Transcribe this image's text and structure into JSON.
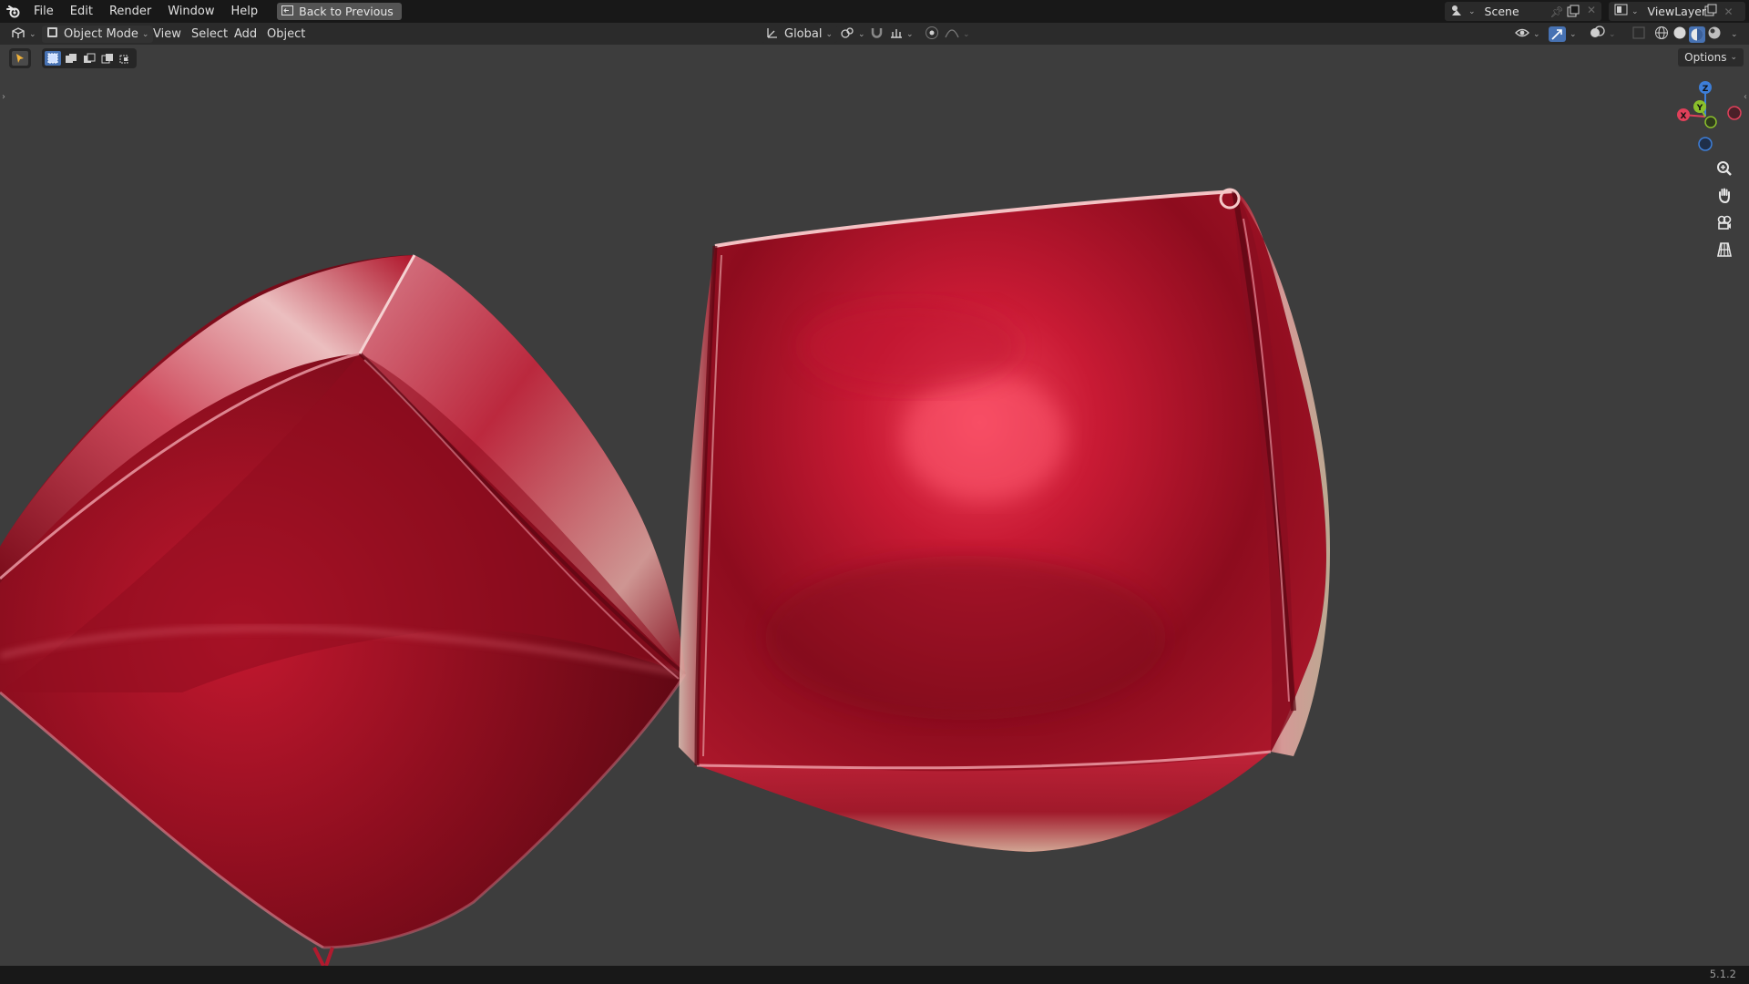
{
  "app": {
    "version": "5.1.2"
  },
  "menu": [
    "File",
    "Edit",
    "Render",
    "Window",
    "Help"
  ],
  "back_button": {
    "label": "Back to Previous"
  },
  "scene": {
    "label": "Scene"
  },
  "view_layer": {
    "label": "ViewLayer"
  },
  "viewport_header": {
    "mode": "Object Mode",
    "menus": [
      "View",
      "Select",
      "Add",
      "Object"
    ],
    "orientation": "Global"
  },
  "options_label": "Options",
  "gizmo_axes": {
    "x": "X",
    "y": "Y",
    "z": "Z"
  },
  "colors": {
    "accent": "#4772b3",
    "x_axis": "#e0405a",
    "y_axis": "#8bc02b",
    "z_axis": "#3d7ed8",
    "balloon_red": "#b3152b"
  }
}
